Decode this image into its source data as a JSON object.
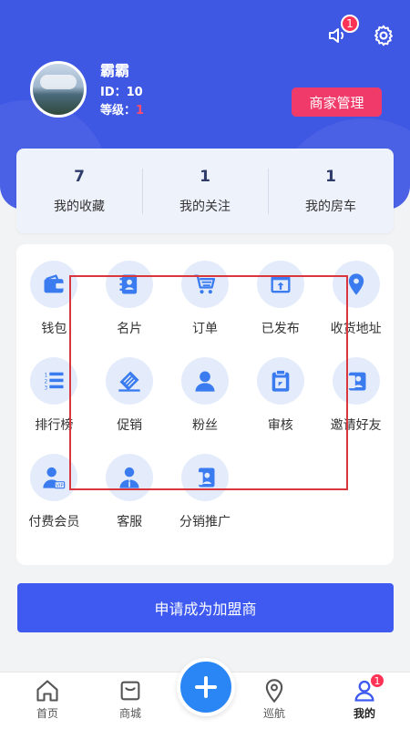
{
  "header": {
    "notification_count": "1",
    "user": {
      "name": "霸霸",
      "id_line": "ID：10",
      "level_label": "等级：",
      "level_value": "1"
    },
    "merchant_button": "商家管理"
  },
  "stats": [
    {
      "value": "7",
      "label": "我的收藏"
    },
    {
      "value": "1",
      "label": "我的关注"
    },
    {
      "value": "1",
      "label": "我的房车"
    }
  ],
  "menu": [
    {
      "label": "钱包",
      "icon": "wallet-icon"
    },
    {
      "label": "名片",
      "icon": "card-icon"
    },
    {
      "label": "订单",
      "icon": "cart-icon"
    },
    {
      "label": "已发布",
      "icon": "publish-icon"
    },
    {
      "label": "收货地址",
      "icon": "location-icon"
    },
    {
      "label": "排行榜",
      "icon": "ranking-icon"
    },
    {
      "label": "促销",
      "icon": "promotion-icon"
    },
    {
      "label": "粉丝",
      "icon": "fans-icon"
    },
    {
      "label": "审核",
      "icon": "review-icon"
    },
    {
      "label": "邀请好友",
      "icon": "invite-icon"
    },
    {
      "label": "付费会员",
      "icon": "vip-icon"
    },
    {
      "label": "客服",
      "icon": "service-icon"
    },
    {
      "label": "分销推广",
      "icon": "distribution-icon"
    }
  ],
  "apply_button": "申请成为加盟商",
  "tabbar": {
    "items": [
      {
        "label": "首页",
        "icon": "home-icon"
      },
      {
        "label": "商城",
        "icon": "mall-icon"
      },
      {
        "label": "巡航",
        "icon": "cruise-icon"
      },
      {
        "label": "我的",
        "icon": "profile-icon",
        "badge": "1",
        "active": true
      }
    ]
  },
  "colors": {
    "primary": "#3f58e4",
    "accent": "#f03a6a",
    "badge": "#ff3355",
    "fab": "#2a86f5"
  }
}
